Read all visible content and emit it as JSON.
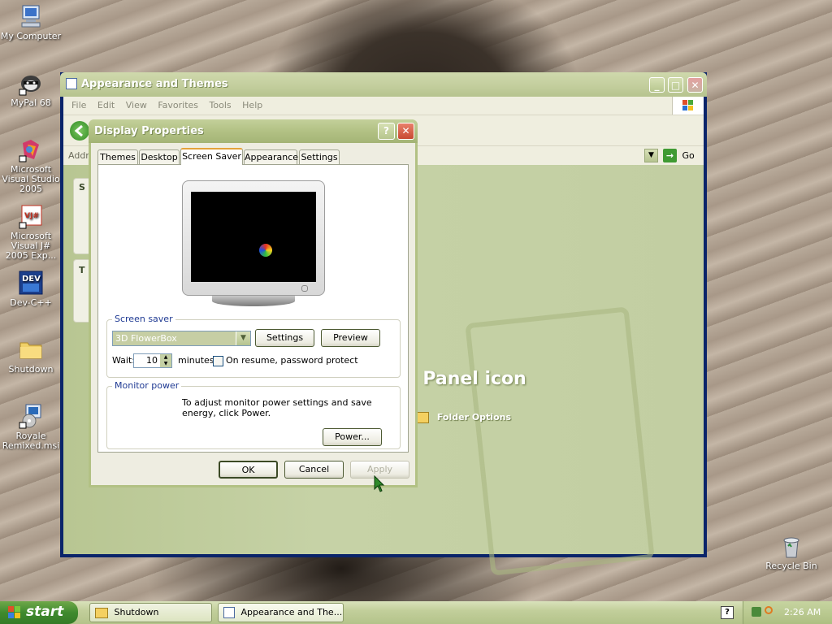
{
  "desktop": {
    "icons": [
      {
        "label": "My Computer",
        "icon": "computer-icon"
      },
      {
        "label": "MyPal 68",
        "icon": "raccoon-icon"
      },
      {
        "label": "Microsoft Visual Studio 2005",
        "icon": "visual-studio-icon"
      },
      {
        "label": "Microsoft Visual J# 2005 Exp...",
        "icon": "vjsharp-icon"
      },
      {
        "label": "Dev-C++",
        "icon": "devcpp-icon"
      },
      {
        "label": "Shutdown",
        "icon": "folder-icon"
      },
      {
        "label": "Royale Remixed.msi",
        "icon": "installer-icon"
      }
    ],
    "recycle_bin": {
      "label": "Recycle Bin",
      "icon": "recycle-bin-icon"
    }
  },
  "explorer": {
    "title": "Appearance and Themes",
    "menu": [
      "File",
      "Edit",
      "View",
      "Favorites",
      "Tools",
      "Help"
    ],
    "address_label": "Addre",
    "go_label": "Go",
    "pick_text": "ol Panel icon",
    "folder_options_label": "Folder Options",
    "side_fragments": {
      "s": "S",
      "t": "T"
    }
  },
  "dialog": {
    "title": "Display Properties",
    "tabs": [
      "Themes",
      "Desktop",
      "Screen Saver",
      "Appearance",
      "Settings"
    ],
    "active_tab": "Screen Saver",
    "screen_saver": {
      "group_label": "Screen saver",
      "selected": "3D FlowerBox",
      "settings_label": "Settings",
      "preview_label": "Preview",
      "wait_label": "Wait:",
      "wait_value": "10",
      "minutes_label": "minutes",
      "password_label": "On resume, password protect",
      "password_checked": false
    },
    "monitor_power": {
      "group_label": "Monitor power",
      "description": "To adjust monitor power settings and save energy, click Power.",
      "power_label": "Power..."
    },
    "ok_label": "OK",
    "cancel_label": "Cancel",
    "apply_label": "Apply",
    "apply_enabled": false
  },
  "taskbar": {
    "start_label": "start",
    "tasks": [
      {
        "label": "Shutdown",
        "icon": "folder-icon"
      },
      {
        "label": "Appearance and The...",
        "icon": "control-panel-icon"
      }
    ],
    "clock": "2:26 AM",
    "help_glyph": "?"
  },
  "colors": {
    "theme_olive": "#b2c184",
    "title_text": "#ffffff",
    "start_green": "#3f8a2e",
    "close_red": "#d0553b"
  }
}
